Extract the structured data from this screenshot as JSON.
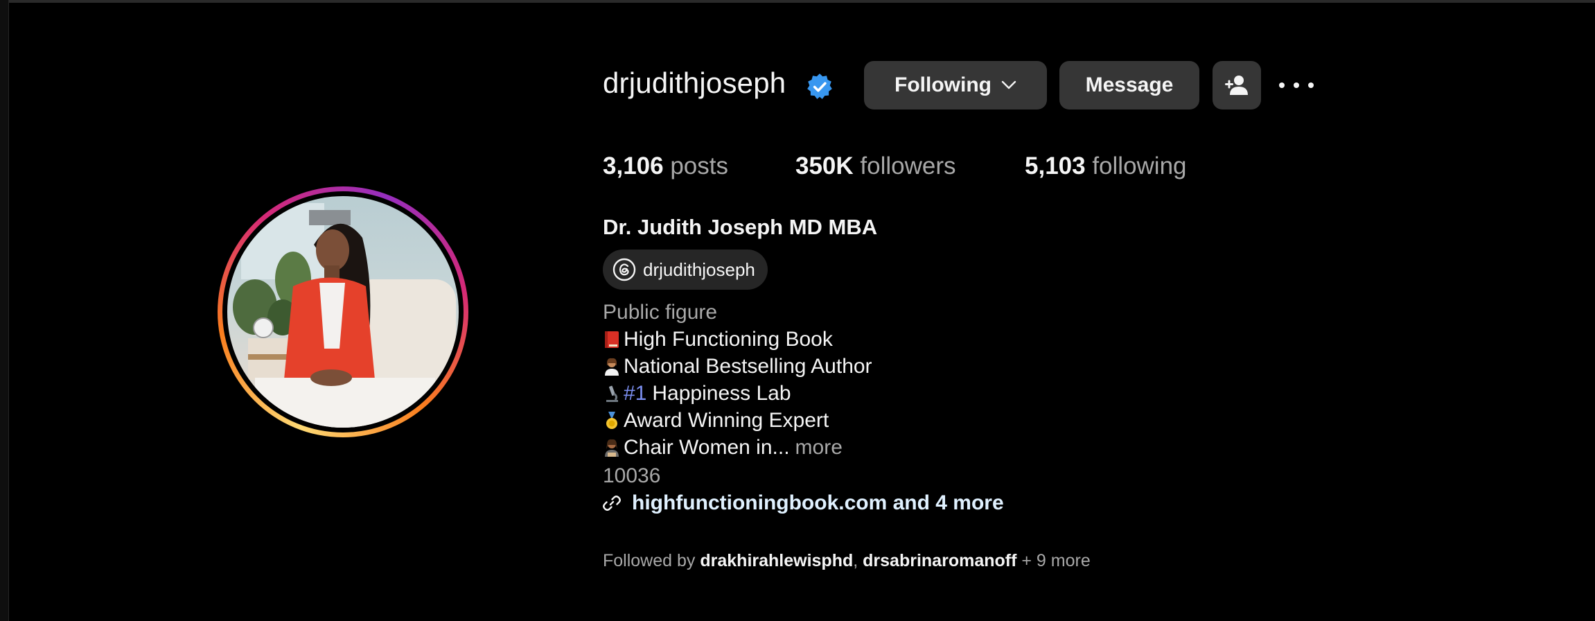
{
  "profile": {
    "username": "drjudithjoseph",
    "verified": true,
    "full_name": "Dr. Judith Joseph MD MBA",
    "threads_handle": "drjudithjoseph",
    "category": "Public figure"
  },
  "actions": {
    "following_label": "Following",
    "message_label": "Message",
    "add_user_icon": "person-add-icon",
    "more_icon": "more-horizontal-icon"
  },
  "stats": {
    "posts_count": "3,106",
    "posts_label": "posts",
    "followers_count": "350K",
    "followers_label": "followers",
    "following_count": "5,103",
    "following_label": "following"
  },
  "bio": {
    "line1_text": "High Functioning Book",
    "line2_text": "National Bestselling Author",
    "line3_hashtag": "#1",
    "line3_text": "Happiness Lab",
    "line4_text": "Award Winning Expert",
    "line5_text": "Chair Women in...",
    "more_label": "more",
    "zip": "10036",
    "link_text": "highfunctioningbook.com and 4 more"
  },
  "followed_by": {
    "prefix": "Followed by",
    "user1": "drakhirahlewisphd",
    "separator": ",",
    "user2": "drsabrinaromanoff",
    "suffix": "+ 9 more"
  },
  "colors": {
    "background": "#000000",
    "button_bg": "#363636",
    "verified_blue": "#3897f0",
    "hashtag": "#7c8ff0",
    "secondary_text": "#a8a8a8"
  }
}
